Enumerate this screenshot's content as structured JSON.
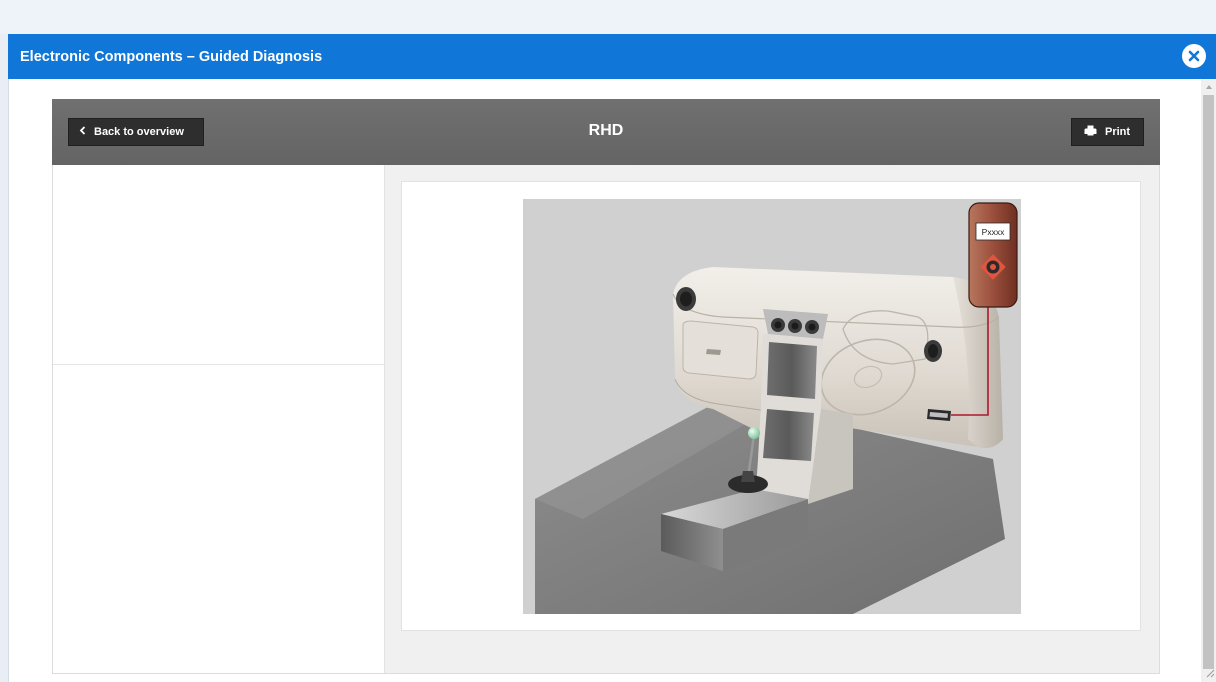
{
  "window": {
    "title": "Electronic Components – Guided Diagnosis",
    "close_icon": "close-icon"
  },
  "header": {
    "title": "RHD",
    "back_label": "Back to overview",
    "back_icon": "chevron-left-icon",
    "print_label": "Print",
    "print_icon": "printer-icon"
  },
  "figure": {
    "subject": "right-hand-drive dashboard with diagnostic connector",
    "tester_label": "Pxxxx"
  },
  "colors": {
    "title_bar": "#1077d9",
    "panel_header": "#6a6a6a",
    "button": "#2e2e2e",
    "tester_body": "#9a4f3c",
    "cable": "#b0182e"
  }
}
